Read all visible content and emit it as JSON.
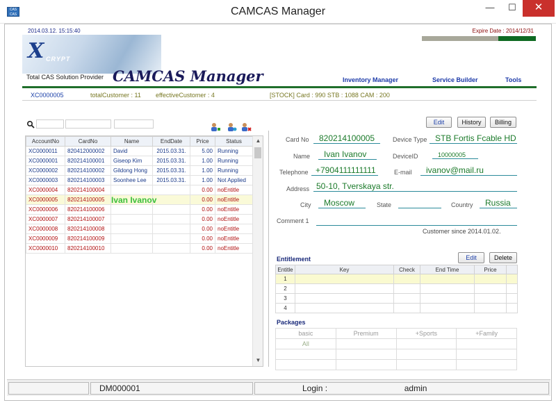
{
  "window": {
    "title": "CAMCAS Manager",
    "minimize": "—",
    "maximize": "☐",
    "close": "✕",
    "icon_label": "CAS CAS"
  },
  "header": {
    "datetime": "2014.03.12. 15:15:40",
    "expire": "Expire Date : 2014/12/31",
    "logo_x": "X",
    "logo_text": "CRYPT",
    "tagline": "Total CAS Solution Provider",
    "app_name": "CAMCAS Manager",
    "menu": [
      "Inventory Manager",
      "Service Builder",
      "Tools"
    ]
  },
  "stats": {
    "account": "XC0000005",
    "total_customer": "totalCustomer : 11",
    "effective_customer": "effectiveCustomer : 4",
    "stock": "[STOCK]   Card : 990     STB : 1088     CAM : 200"
  },
  "grid": {
    "columns": [
      "AccountNo",
      "CardNo",
      "Name",
      "EndDate",
      "Price",
      "Status"
    ],
    "rows": [
      [
        "XC0000011",
        "820412000002",
        "David",
        "2015.03.31.",
        "5.00",
        "Running"
      ],
      [
        "XC0000001",
        "820214100001",
        "Giseop Kim",
        "2015.03.31.",
        "1.00",
        "Running"
      ],
      [
        "XC0000002",
        "820214100002",
        "Gildong Hong",
        "2015.03.31.",
        "1.00",
        "Running"
      ],
      [
        "XC0000003",
        "820214100003",
        "Soonhee Lee",
        "2015.03.31.",
        "1.00",
        "Not Applied"
      ],
      [
        "XC0000004",
        "820214100004",
        "",
        "",
        "0.00",
        "noEntitle"
      ],
      [
        "XC0000005",
        "820214100005",
        "",
        "",
        "0.00",
        "noEntitle"
      ],
      [
        "XC0000006",
        "820214100006",
        "",
        "",
        "0.00",
        "noEntitle"
      ],
      [
        "XC0000007",
        "820214100007",
        "",
        "",
        "0.00",
        "noEntitle"
      ],
      [
        "XC0000008",
        "820214100008",
        "",
        "",
        "0.00",
        "noEntitle"
      ],
      [
        "XC0000009",
        "820214100009",
        "",
        "",
        "0.00",
        "noEntitle"
      ],
      [
        "XC0000010",
        "820214100010",
        "",
        "",
        "0.00",
        "noEntitle"
      ]
    ],
    "overlay_name": "Ivan Ivanov"
  },
  "buttons": {
    "edit": "Edit",
    "history": "History",
    "billing": "Billing",
    "ent_edit": "Edit",
    "ent_delete": "Delete"
  },
  "detail": {
    "card_no_label": "Card No",
    "card_no": "820214100005",
    "device_type_label": "Device Type",
    "device_type": "STB Fortis Fcable HD",
    "name_label": "Name",
    "name": "Ivan Ivanov",
    "device_id_label": "DeviceID",
    "device_id": "10000005",
    "telephone_label": "Telephone",
    "telephone": "+7904111111111",
    "email_label": "E-mail",
    "email": "ivanov@mail.ru",
    "address_label": "Address",
    "address": "50-10, Tverskaya str.",
    "city_label": "City",
    "city": "Moscow",
    "state_label": "State",
    "state": "",
    "country_label": "Country",
    "country": "Russia",
    "comment_label": "Comment 1",
    "comment": "",
    "since": "Customer since  2014.01.02."
  },
  "entitlement": {
    "title": "Entitlement",
    "columns": [
      "Entitle",
      "Key",
      "Check",
      "End Time",
      "Price"
    ],
    "rows": [
      "1",
      "2",
      "3",
      "4"
    ]
  },
  "packages": {
    "title": "Packages",
    "headers": [
      "basic",
      "Premium",
      "+Sports",
      "+Family"
    ],
    "row1": [
      "All",
      "",
      "",
      ""
    ]
  },
  "statusbar": {
    "dm": "DM000001",
    "login_label": "Login :",
    "login_user": "admin"
  }
}
